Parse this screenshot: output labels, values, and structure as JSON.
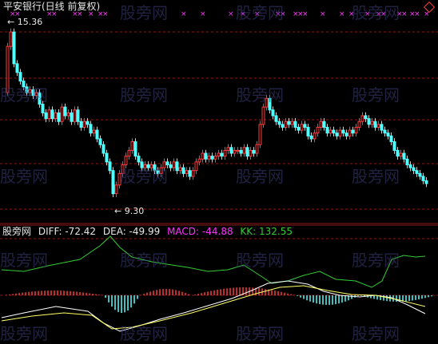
{
  "header": {
    "title": "平安银行(日线 前复权)",
    "diamond_icon": "diamond-icon"
  },
  "price_annotations": {
    "high": "15.36",
    "low": "9.30"
  },
  "indicator": {
    "name": "股旁网",
    "diff": "DIFF: -72.42",
    "dea": "DEA: -49.99",
    "macd": "MACD: -44.88",
    "kk": "KK: 132.55"
  },
  "watermark": "股旁网",
  "colors": {
    "up": "#ff3b3b",
    "down": "#54ffff",
    "grid": "#8b1a1a",
    "diff": "#ffffff",
    "dea": "#ffff66",
    "macd_label": "#ff33ff",
    "kk": "#33cc33",
    "marker": "#ff33ff"
  },
  "price_range": [
    8.8,
    15.6
  ]
}
